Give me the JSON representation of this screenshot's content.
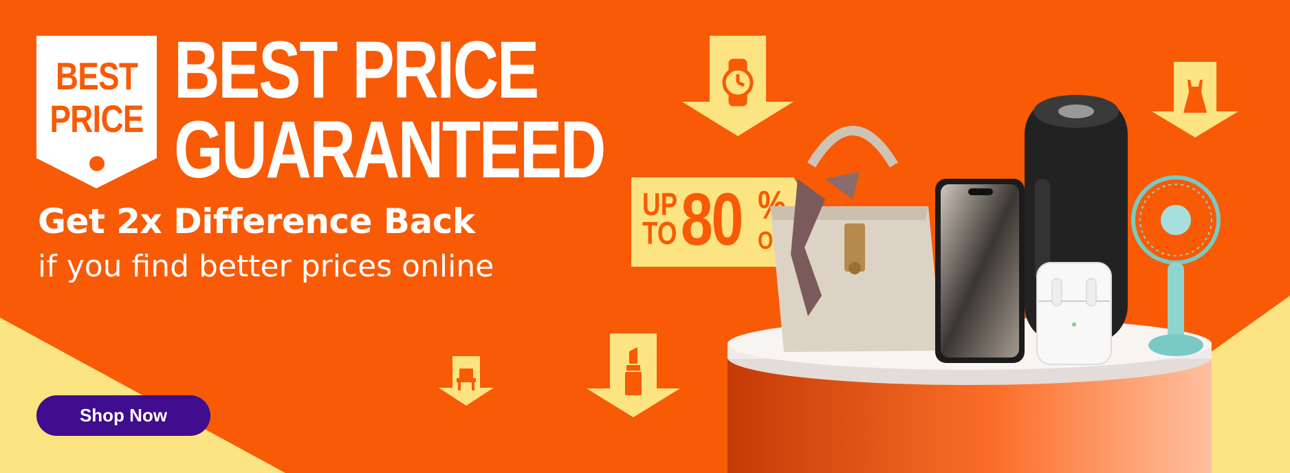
{
  "banner": {
    "badge": {
      "line1": "BEST",
      "line2": "PRICE"
    },
    "headline": {
      "line1": "BEST PRICE",
      "line2": "GUARANTEED"
    },
    "subheadline": "Get 2x Difference Back",
    "tagline": "if you find better prices online",
    "cta_label": "Shop Now",
    "discount": {
      "up": "UP",
      "to": "TO",
      "amount": "80",
      "percent": "%",
      "off": "OFF"
    },
    "arrow_icons": [
      "watch-icon",
      "dress-icon",
      "chair-icon",
      "lipstick-icon"
    ],
    "products": [
      "handbag",
      "smartphone",
      "bluetooth-speaker",
      "wireless-earbuds",
      "handheld-fan"
    ]
  },
  "colors": {
    "background": "#f85a06",
    "accent_yellow": "#fde482",
    "button": "#3f0d8e",
    "text": "#ffffff"
  }
}
